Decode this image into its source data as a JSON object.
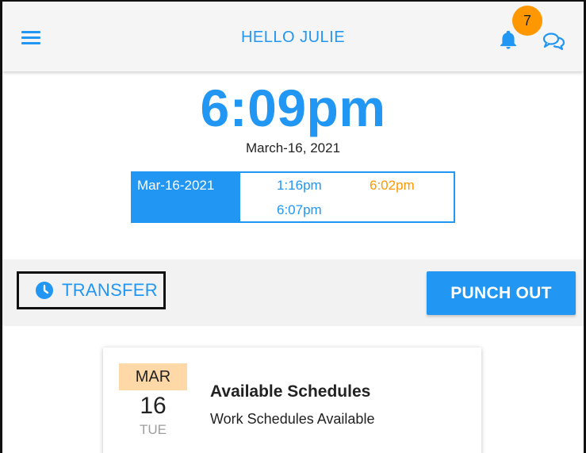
{
  "header": {
    "title": "HELLO JULIE",
    "menu_icon": "hamburger-menu-icon",
    "bell_icon": "bell-icon",
    "notification_count": "7",
    "chat_icon": "chat-bubbles-icon"
  },
  "clock": {
    "time": "6:09pm",
    "date": "March-16, 2021"
  },
  "punches": {
    "date": "Mar-16-2021",
    "in_1": "1:16pm",
    "out_1": "6:02pm",
    "in_2": "6:07pm"
  },
  "actions": {
    "transfer_label": "TRANSFER",
    "transfer_icon": "clock-icon",
    "punch_out_label": "PUNCH OUT"
  },
  "schedule_card": {
    "month": "MAR",
    "day": "16",
    "weekday": "TUE",
    "title": "Available Schedules",
    "subtitle": "Work Schedules Available"
  },
  "colors": {
    "primary": "#2196f3",
    "accent_orange": "#ff9800",
    "month_bg": "#ffd8a8"
  }
}
